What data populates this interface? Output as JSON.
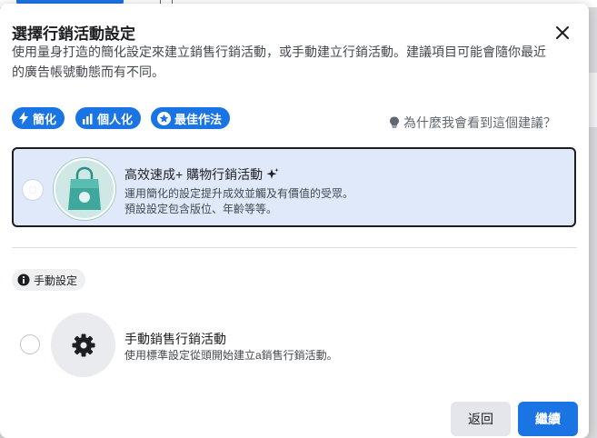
{
  "dialog": {
    "title": "選擇行銷活動設定",
    "subtitle": "使用量身打造的簡化設定來建立銷售行銷活動，或手動建立行銷活動。建議項目可能會隨你最近的廣告帳號動態而有不同。",
    "close_icon": "close-icon"
  },
  "chips": [
    {
      "label": "簡化",
      "icon": "lightning-icon"
    },
    {
      "label": "個人化",
      "icon": "bar-chart-icon"
    },
    {
      "label": "最佳作法",
      "icon": "star-icon"
    }
  ],
  "why_link": {
    "label": "為什麼我會看到這個建議？",
    "icon": "lightbulb-icon"
  },
  "options": {
    "advantage": {
      "title": "高效速成+ 購物行銷活動",
      "desc_line1": "運用簡化的設定提升成效並觸及有價值的受眾。",
      "desc_line2": "預設設定包含版位、年齡等等。",
      "selected": true,
      "icon": "shopping-bag-icon"
    },
    "manual_section_label": "手動設定",
    "manual": {
      "title": "手動銷售行銷活動",
      "desc": "使用標準設定從頭開始建立a銷售行銷活動。",
      "selected": false,
      "icon": "gear-icon"
    }
  },
  "footer": {
    "back_label": "返回",
    "continue_label": "繼續"
  },
  "colors": {
    "accent": "#1b74e4",
    "selected_card_bg": "#dfe9fa"
  }
}
